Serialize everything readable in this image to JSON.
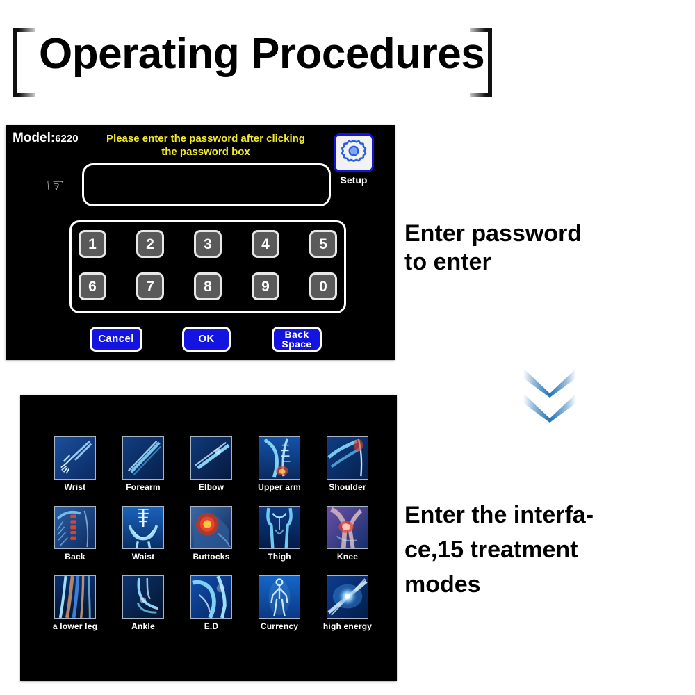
{
  "title": {
    "text": "Operating Procedures"
  },
  "password_screen": {
    "model_prefix": "Model:",
    "model_number": "6220",
    "instruction": "Please enter the password after clicking the password box",
    "password_value": "",
    "password_placeholder": "",
    "hand_icon": "pointing-hand-right",
    "setup": {
      "label": "Setup",
      "icon": "gear-icon",
      "border_color": "#1414d8",
      "icon_color": "#2b5fe0"
    },
    "keypad": {
      "row1": [
        "1",
        "2",
        "3",
        "4",
        "5"
      ],
      "row2": [
        "6",
        "7",
        "8",
        "9",
        "0"
      ]
    },
    "actions": {
      "cancel": "Cancel",
      "ok": "OK",
      "backspace_line1": "Back",
      "backspace_line2": "Space"
    },
    "colors": {
      "background": "#000000",
      "instruction_text": "#f2ea2a",
      "button_blue": "#1414e0",
      "key_gray": "#5a5a5a"
    }
  },
  "captions": {
    "step1_line1": "Enter password",
    "step1_line2": "to enter",
    "step2_line1": "Enter the interfa-",
    "step2_line2": "ce,15 treatment",
    "step2_line3": "modes"
  },
  "arrows": {
    "icon": "double-chevron-down-icon",
    "color": "#1f72b8",
    "count": 2
  },
  "modes_screen": {
    "background": "#000000",
    "count": 15,
    "modes": [
      {
        "label": "Wrist",
        "icon": "xray-wrist-icon"
      },
      {
        "label": "Forearm",
        "icon": "xray-forearm-icon"
      },
      {
        "label": "Elbow",
        "icon": "xray-elbow-icon"
      },
      {
        "label": "Upper arm",
        "icon": "xray-upper-arm-icon"
      },
      {
        "label": "Shoulder",
        "icon": "xray-shoulder-icon"
      },
      {
        "label": "Back",
        "icon": "xray-back-icon"
      },
      {
        "label": "Waist",
        "icon": "xray-waist-icon"
      },
      {
        "label": "Buttocks",
        "icon": "xray-buttocks-icon"
      },
      {
        "label": "Thigh",
        "icon": "xray-thigh-icon"
      },
      {
        "label": "Knee",
        "icon": "xray-knee-icon"
      },
      {
        "label": "a lower leg",
        "icon": "xray-lower-leg-icon"
      },
      {
        "label": "Ankle",
        "icon": "xray-ankle-icon"
      },
      {
        "label": "E.D",
        "icon": "xray-ed-icon"
      },
      {
        "label": "Currency",
        "icon": "xray-currency-icon"
      },
      {
        "label": "high energy",
        "icon": "xray-high-energy-icon"
      }
    ]
  }
}
